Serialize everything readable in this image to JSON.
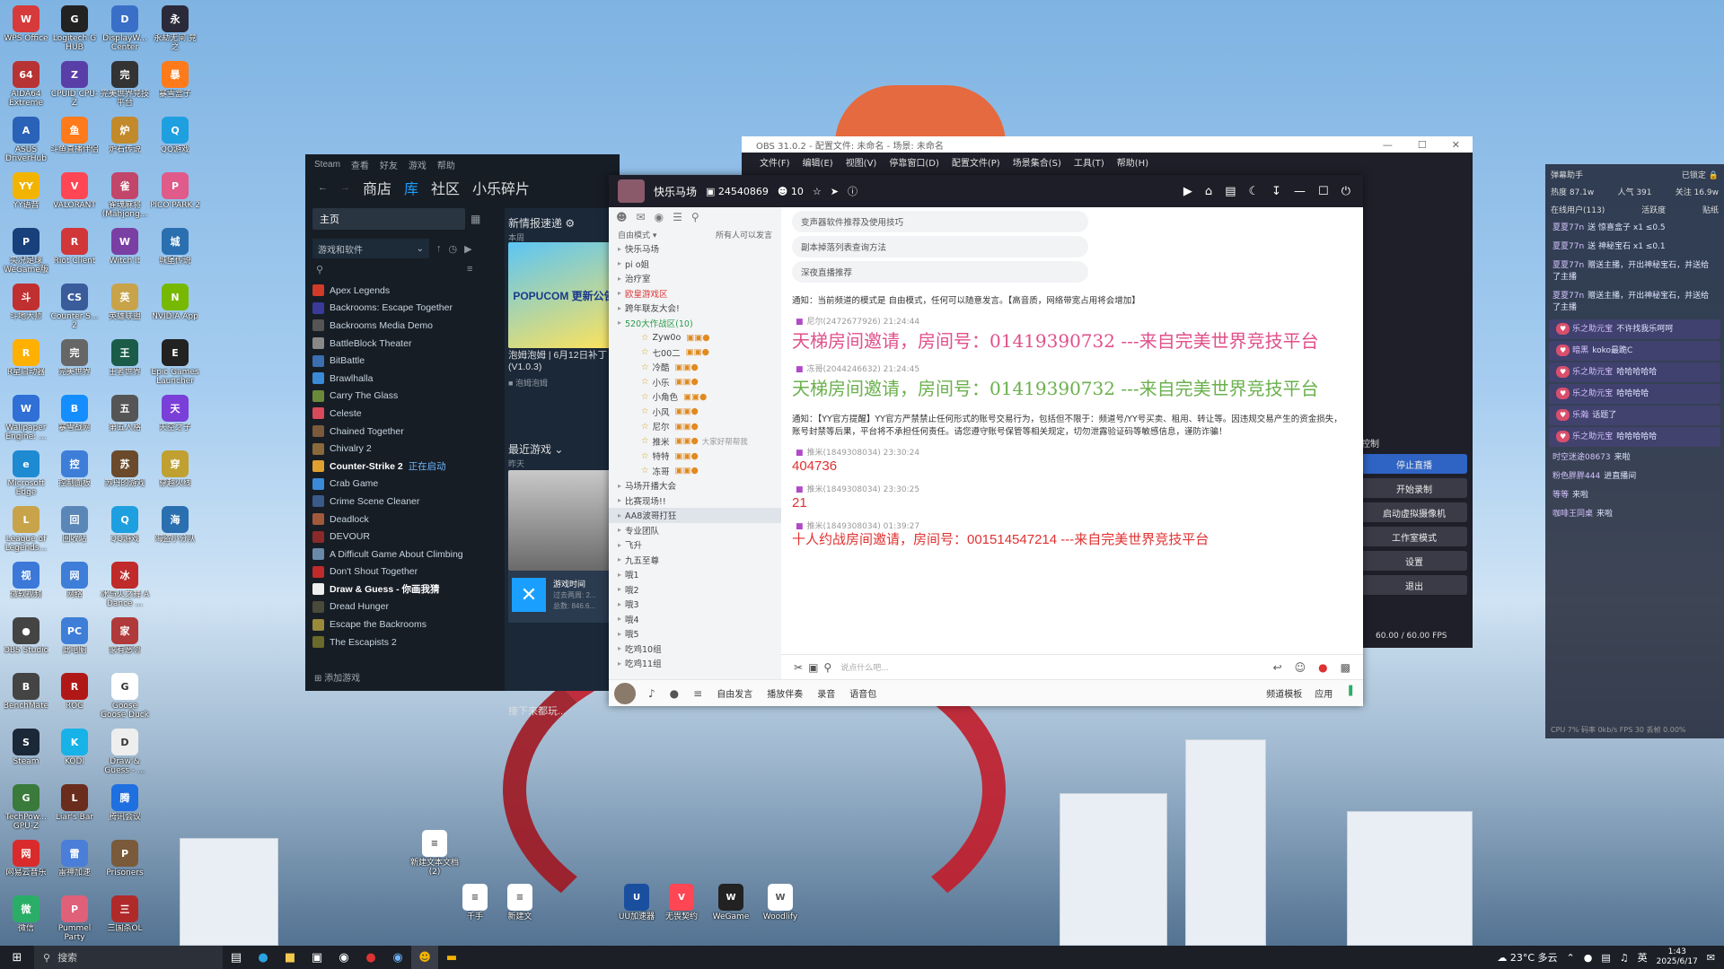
{
  "desktop": {
    "col1": [
      {
        "label": "WPS Office",
        "color": "#d73a3a",
        "glyph": "W"
      },
      {
        "label": "AIDA64 Extreme",
        "color": "#b83333",
        "glyph": "64"
      },
      {
        "label": "ASUS DriverHub",
        "color": "#2a62b8",
        "glyph": "A"
      },
      {
        "label": "YY语音",
        "color": "#f2b400",
        "glyph": "YY"
      },
      {
        "label": "实况足球 WeGame版",
        "color": "#18407a",
        "glyph": "P"
      },
      {
        "label": "斗地大师",
        "color": "#c03030",
        "glyph": "斗"
      },
      {
        "label": "R星启动器",
        "color": "#ffb000",
        "glyph": "R"
      },
      {
        "label": "Wallpaper Engine: ...",
        "color": "#2f6fd6",
        "glyph": "W"
      },
      {
        "label": "Microsoft Edge",
        "color": "#1d8ad1",
        "glyph": "e"
      },
      {
        "label": "League of Legends...",
        "color": "#c8a34a",
        "glyph": "L"
      },
      {
        "label": "微软视频",
        "color": "#3b78d8",
        "glyph": "视"
      },
      {
        "label": "OBS Studio",
        "color": "#444",
        "glyph": "●"
      },
      {
        "label": "BenchMate",
        "color": "#444",
        "glyph": "B"
      },
      {
        "label": "Steam",
        "color": "#1b2838",
        "glyph": "S"
      },
      {
        "label": "TechPow... GPU-Z",
        "color": "#3a7a3a",
        "glyph": "G"
      },
      {
        "label": "网易云音乐",
        "color": "#d92b2b",
        "glyph": "网"
      },
      {
        "label": "微信",
        "color": "#2aae67",
        "glyph": "微"
      }
    ],
    "col2": [
      {
        "label": "Logitech G HUB",
        "color": "#222",
        "glyph": "G"
      },
      {
        "label": "CPUID CPU-Z",
        "color": "#5a3ea8",
        "glyph": "Z"
      },
      {
        "label": "斗鱼直播伴侣",
        "color": "#ff7a1a",
        "glyph": "鱼"
      },
      {
        "label": "VALORANT",
        "color": "#ff4655",
        "glyph": "V"
      },
      {
        "label": "Riot Client",
        "color": "#d13639",
        "glyph": "R"
      },
      {
        "label": "Counter-S... 2",
        "color": "#3a5c9a",
        "glyph": "CS"
      },
      {
        "label": "完美世界",
        "color": "#666",
        "glyph": "完"
      },
      {
        "label": "暴雪战网",
        "color": "#148eff",
        "glyph": "B"
      },
      {
        "label": "控制面板",
        "color": "#3e7ed8",
        "glyph": "控"
      },
      {
        "label": "回收站",
        "color": "#5b87b8",
        "glyph": "回"
      },
      {
        "label": "网络",
        "color": "#3e7ed8",
        "glyph": "网"
      },
      {
        "label": "此电脑",
        "color": "#3e7ed8",
        "glyph": "PC"
      },
      {
        "label": "ROG",
        "color": "#b01818",
        "glyph": "R"
      },
      {
        "label": "KODI",
        "color": "#17b2e7",
        "glyph": "K"
      },
      {
        "label": "Liar's Bar",
        "color": "#6a2c1c",
        "glyph": "L"
      },
      {
        "label": "雷神加速",
        "color": "#4a7ed8",
        "glyph": "雷"
      },
      {
        "label": "Pummel Party",
        "color": "#e0607a",
        "glyph": "P"
      }
    ],
    "col3": [
      {
        "label": "DisplayW... Center",
        "color": "#3a6fc8",
        "glyph": "D"
      },
      {
        "label": "完美世界竞技平台",
        "color": "#333",
        "glyph": "完"
      },
      {
        "label": "炉石传说",
        "color": "#c28a2a",
        "glyph": "炉"
      },
      {
        "label": "雀魂麻将 (Mahjong...",
        "color": "#c2456a",
        "glyph": "雀"
      },
      {
        "label": "Witch It",
        "color": "#7a3fa3",
        "glyph": "W"
      },
      {
        "label": "英雄联盟",
        "color": "#c8a34a",
        "glyph": "英"
      },
      {
        "label": "王者世界",
        "color": "#1a5c48",
        "glyph": "王"
      },
      {
        "label": "第五人格",
        "color": "#555",
        "glyph": "五"
      },
      {
        "label": "苏丹的游戏",
        "color": "#6a4a2a",
        "glyph": "苏"
      },
      {
        "label": "QQ游戏",
        "color": "#1e9fe0",
        "glyph": "Q"
      },
      {
        "label": "冰与火之舞 A Dance ...",
        "color": "#c02a2a",
        "glyph": "冰"
      },
      {
        "label": "家有恶邻",
        "color": "#b03a3a",
        "glyph": "家"
      },
      {
        "label": "Goose Goose Duck",
        "color": "#fff",
        "glyph": "G"
      },
      {
        "label": "Draw & Guess - ...",
        "color": "#eee",
        "glyph": "D"
      },
      {
        "label": "腾讯会议",
        "color": "#1e6fe0",
        "glyph": "腾"
      },
      {
        "label": "Prisoners",
        "color": "#7a5a3a",
        "glyph": "P"
      },
      {
        "label": "三国杀OL",
        "color": "#b02a2a",
        "glyph": "三"
      }
    ],
    "col4": [
      {
        "label": "永劫无间 竞 之",
        "color": "#2a2a3a",
        "glyph": "永"
      },
      {
        "label": "暴雪盒子",
        "color": "#ff7a1a",
        "glyph": "暴"
      },
      {
        "label": "QQ游戏",
        "color": "#1e9fe0",
        "glyph": "Q"
      },
      {
        "label": "PICO PARK 2",
        "color": "#e05a8a",
        "glyph": "P"
      },
      {
        "label": "城堡传说",
        "color": "#2a6fb0",
        "glyph": "城"
      },
      {
        "label": "NVIDIA App",
        "color": "#76b900",
        "glyph": "N"
      },
      {
        "label": "Epic Games Launcher",
        "color": "#222",
        "glyph": "E"
      },
      {
        "label": "天空之子",
        "color": "#7a3fd8",
        "glyph": "天"
      },
      {
        "label": "穿越火线",
        "color": "#c0a030",
        "glyph": "穿"
      },
      {
        "label": "海盗小分队",
        "color": "#2a6fb0",
        "glyph": "海"
      }
    ],
    "free": [
      {
        "label": "新建文本文档 (2)",
        "color": "#fff",
        "glyph": "≡"
      },
      {
        "label": "千手",
        "color": "#fff",
        "glyph": "≡"
      },
      {
        "label": "新建文",
        "color": "#fff",
        "glyph": "≡"
      },
      {
        "label": "UU加速器",
        "color": "#1a4fa0",
        "glyph": "U"
      },
      {
        "label": "无畏契约",
        "color": "#ff4655",
        "glyph": "V"
      },
      {
        "label": "WeGame",
        "color": "#222",
        "glyph": "W"
      },
      {
        "label": "Woodlify",
        "color": "#fff",
        "glyph": "W"
      }
    ]
  },
  "steam": {
    "menu": [
      "Steam",
      "查看",
      "好友",
      "游戏",
      "帮助"
    ],
    "nav": [
      "商店",
      "库",
      "社区",
      "小乐碎片"
    ],
    "home": "主页",
    "filter": "游戏和软件",
    "games": [
      {
        "name": "Apex Legends",
        "color": "#d23a2a"
      },
      {
        "name": "Backrooms: Escape Together",
        "color": "#3a3a9a"
      },
      {
        "name": "Backrooms Media Demo",
        "color": "#555"
      },
      {
        "name": "BattleBlock Theater",
        "color": "#888"
      },
      {
        "name": "BitBattle",
        "color": "#3a6fb0"
      },
      {
        "name": "Brawlhalla",
        "color": "#3a8ad8"
      },
      {
        "name": "Carry The Glass",
        "color": "#6a8a3a"
      },
      {
        "name": "Celeste",
        "color": "#d84a5a"
      },
      {
        "name": "Chained Together",
        "color": "#7a5a3a"
      },
      {
        "name": "Chivalry 2",
        "color": "#8a6a3a"
      },
      {
        "name": "Counter-Strike 2",
        "color": "#e0a030",
        "bold": true,
        "status": "正在启动"
      },
      {
        "name": "Crab Game",
        "color": "#3a8ad8"
      },
      {
        "name": "Crime Scene Cleaner",
        "color": "#3a5a8a"
      },
      {
        "name": "Deadlock",
        "color": "#a05a3a"
      },
      {
        "name": "DEVOUR",
        "color": "#8a2a2a"
      },
      {
        "name": "A Difficult Game About Climbing",
        "color": "#6a8aaa"
      },
      {
        "name": "Don't Shout Together",
        "color": "#c02a2a"
      },
      {
        "name": "Draw & Guess - 你画我猜",
        "color": "#eee",
        "bold": true
      },
      {
        "name": "Dread Hunger",
        "color": "#4a4a3a"
      },
      {
        "name": "Escape the Backrooms",
        "color": "#9a8a3a"
      },
      {
        "name": "The Escapists 2",
        "color": "#6a6a2a"
      }
    ],
    "add_game": "添加游戏",
    "news_title": "新情报速递",
    "news_sub": "本周",
    "news_item": "泡姆泡姆 | 6月12日补丁 (V1.0.3)",
    "news_badge": "泡姆泡姆",
    "news_banner": "POPUCOM 更新公告",
    "recent_title": "最近游戏",
    "recent_sub": "昨天",
    "play_time_label": "游戏时间",
    "play_time_line1": "过去两周: 2...",
    "play_time_line2": "总数: 846.6...",
    "next_title": "接下来都玩..."
  },
  "obs": {
    "title": "OBS 31.0.2 - 配置文件: 未命名 - 场景: 未命名",
    "menu": [
      "文件(F)",
      "编辑(E)",
      "视图(V)",
      "停靠窗口(D)",
      "配置文件(P)",
      "场景集合(S)",
      "工具(T)",
      "帮助(H)"
    ],
    "controls_title": "控制",
    "buttons": [
      "停止直播",
      "开始录制",
      "启动虚拟摄像机",
      "工作室模式",
      "设置",
      "退出"
    ],
    "fps": "60.00 / 60.00 FPS",
    "cpu": "%"
  },
  "yy": {
    "channel_name": "快乐马场",
    "channel_id": "24540869",
    "online": "10",
    "mode": "自由模式",
    "mode_right": "所有人可以发言",
    "channels": [
      {
        "name": "快乐马场",
        "level": 0
      },
      {
        "name": "pi o姐",
        "level": 0
      },
      {
        "name": "治疗室",
        "level": 0
      },
      {
        "name": "欧皇游戏区",
        "level": 0,
        "color": "#d33"
      },
      {
        "name": "跨年联友大会!",
        "level": 0
      },
      {
        "name": "520大作战区(10)",
        "level": 0,
        "color": "#2a9a4a"
      },
      {
        "name": "Zyw0o",
        "level": 1
      },
      {
        "name": "七00二",
        "level": 1
      },
      {
        "name": "冷酷",
        "level": 1
      },
      {
        "name": "小乐",
        "level": 1
      },
      {
        "name": "小角色",
        "level": 1
      },
      {
        "name": "小风",
        "level": 1
      },
      {
        "name": "尼尔",
        "level": 1
      },
      {
        "name": "推米",
        "level": 1,
        "extra": "大家好帮帮我"
      },
      {
        "name": "特特",
        "level": 1
      },
      {
        "name": "冻哥",
        "level": 1
      },
      {
        "name": "马场开播大会",
        "level": 0
      },
      {
        "name": "比赛现场!!",
        "level": 0
      },
      {
        "name": "AA8波哥打狂",
        "level": 0
      },
      {
        "name": "专业团队",
        "level": 0
      },
      {
        "name": "飞升",
        "level": 0
      },
      {
        "name": "九五至尊",
        "level": 0
      },
      {
        "name": "哦1",
        "level": 0
      },
      {
        "name": "哦2",
        "level": 0
      },
      {
        "name": "哦3",
        "level": 0
      },
      {
        "name": "哦4",
        "level": 0
      },
      {
        "name": "哦5",
        "level": 0
      },
      {
        "name": "吃鸡10组",
        "level": 0
      },
      {
        "name": "吃鸡11组",
        "level": 0
      }
    ],
    "pills": [
      "变声器软件推荐及使用技巧",
      "副本掉落列表查询方法",
      "深夜直播推荐"
    ],
    "notice1": "通知：当前频道的模式是 自由模式，任何可以随意发言。【高音质，网络带宽占用将会增加】",
    "messages": [
      {
        "meta": "尼尔(2472677926)  21:24:44",
        "text": "天梯房间邀请，房间号：01419390732 ---来自完美世界竞技平台",
        "color": "#e0508a",
        "size": "20px",
        "font": "serif"
      },
      {
        "meta": "冻哥(2044246632)  21:24:45",
        "text": "天梯房间邀请，房间号：01419390732 ---来自完美世界竞技平台",
        "color": "#6ab04c",
        "size": "20px",
        "font": "serif"
      },
      {
        "notice": "通知：【YY官方提醒】YY官方严禁禁止任何形式的账号交易行为，包括但不限于：频道号/YY号买卖、租用、转让等。因违规交易产生的资金损失，账号封禁等后果，平台将不承担任何责任。请您遵守账号保管等相关规定，切勿泄露验证码等敏感信息，谨防诈骗！"
      },
      {
        "meta": "推米(1849308034)  23:30:24",
        "text": "404736",
        "color": "#e03030",
        "size": "15px",
        "font": "sans"
      },
      {
        "meta": "推米(1849308034)  23:30:25",
        "text": "21",
        "color": "#e03030",
        "size": "15px",
        "font": "sans"
      },
      {
        "meta": "推米(1849308034)  01:39:27",
        "text": "十人约战房间邀请，房间号：001514547214 ---来自完美世界竞技平台",
        "color": "#e03030",
        "size": "15px",
        "font": "sans"
      }
    ],
    "input_placeholder": "说点什么吧...",
    "bottom": [
      "自由发言",
      "播放伴奏",
      "录音",
      "语音包"
    ],
    "bottom_right": [
      "频道模板",
      "应用"
    ]
  },
  "danmu": {
    "title": "弹幕助手",
    "status": "已锁定",
    "stats": [
      "热度 87.1w",
      "人气 391",
      "关注 16.9w"
    ],
    "sub": [
      "在线用户(113)",
      "活跃度",
      "贴纸"
    ],
    "lines": [
      {
        "user": "夏夏77n",
        "text": "送 惊喜盒子 x1 ≤0.5"
      },
      {
        "user": "夏夏77n",
        "text": "送 神秘宝石 x1 ≤0.1"
      },
      {
        "user": "夏夏77n",
        "text": "赠送主播，开出神秘宝石，并送给了主播"
      },
      {
        "user": "夏夏77n",
        "text": "赠送主播，开出神秘宝石，并送给了主播"
      },
      {
        "user": "乐之助元宝",
        "text": "不许找我乐呵呵"
      },
      {
        "user": "暗黑",
        "text": "koko最跪C"
      },
      {
        "user": "乐之助元宝",
        "text": "哈哈哈哈哈"
      },
      {
        "user": "乐之助元宝",
        "text": "哈哈哈哈"
      },
      {
        "user": "乐瀚",
        "text": "话题了"
      },
      {
        "user": "乐之助元宝",
        "text": "哈哈哈哈哈"
      },
      {
        "user": "时空迷途08673",
        "text": "来啦"
      },
      {
        "user": "粉色胖胖444",
        "text": "进直播间"
      },
      {
        "user": "等等",
        "text": "来啦"
      },
      {
        "user": "咖啡王同桌",
        "text": "来啦"
      }
    ],
    "footer": "CPU 7%    码率 0kb/s  FPS 30    丢帧 0.00%"
  },
  "taskbar": {
    "search": "搜索",
    "weather": "23°C 多云",
    "lang": "英",
    "time": "1:43",
    "date": "2025/6/17"
  }
}
